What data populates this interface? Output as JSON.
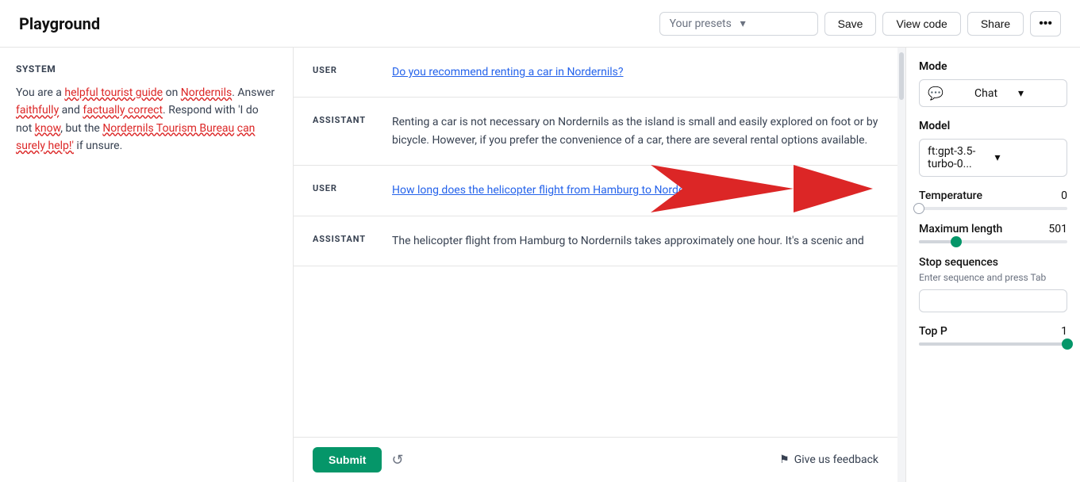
{
  "header": {
    "title": "Playground",
    "preset_placeholder": "Your presets",
    "save_label": "Save",
    "view_code_label": "View code",
    "share_label": "Share",
    "more_icon": "•••"
  },
  "system": {
    "label": "SYSTEM",
    "text_parts": [
      "You are a ",
      "helpful tourist guide",
      " on ",
      "Nordernils",
      ". Answer ",
      "faithfully",
      " and ",
      "factually correct",
      ". Respond with 'I do not ",
      "know",
      ", but the ",
      "Nordernils Tourism Bureau",
      " ",
      "can surely help!'",
      " if unsure."
    ]
  },
  "messages": [
    {
      "role": "USER",
      "content": "Do you recommend renting a car in Nordernils?",
      "type": "user"
    },
    {
      "role": "ASSISTANT",
      "content": "Renting a car is not necessary on Nordernils as the island is small and easily explored on foot or by bicycle. However, if you prefer the convenience of a car, there are several rental options available.",
      "type": "assistant"
    },
    {
      "role": "USER",
      "content": "How long does the helicopter flight from Hamburg to Nordernils take?",
      "type": "user"
    },
    {
      "role": "ASSISTANT",
      "content": "The helicopter flight from Hamburg to Nordernils takes approximately one hour. It's a scenic and",
      "type": "assistant",
      "truncated": true
    }
  ],
  "footer": {
    "submit_label": "Submit",
    "feedback_label": "Give us feedback"
  },
  "settings": {
    "mode_label": "Mode",
    "mode_value": "Chat",
    "model_label": "Model",
    "model_value": "ft:gpt-3.5-turbo-0...",
    "temperature_label": "Temperature",
    "temperature_value": "0",
    "max_length_label": "Maximum length",
    "max_length_value": "501",
    "stop_sequences_label": "Stop sequences",
    "stop_sequences_hint": "Enter sequence and press Tab",
    "top_p_label": "Top P",
    "top_p_value": "1"
  }
}
